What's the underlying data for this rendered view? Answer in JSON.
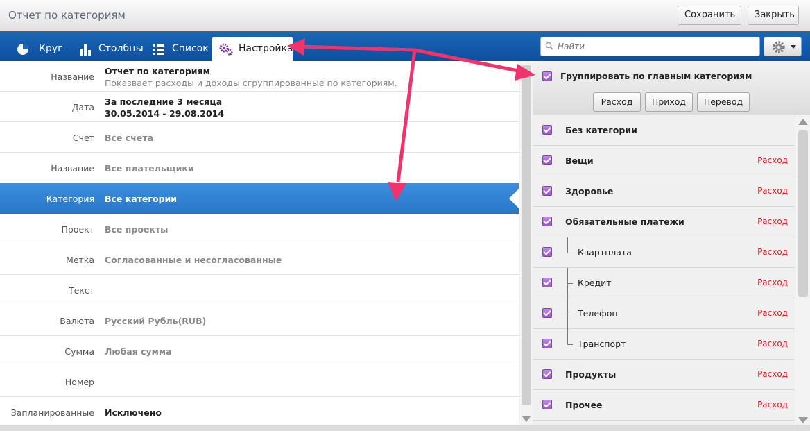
{
  "window": {
    "title": "Отчет по категориям",
    "save_label": "Сохранить",
    "close_label": "Закрыть"
  },
  "tabs": [
    {
      "label": "Круг",
      "icon": "pie-chart-icon"
    },
    {
      "label": "Столбцы",
      "icon": "bar-chart-icon"
    },
    {
      "label": "Список",
      "icon": "list-icon"
    },
    {
      "label": "Настройка",
      "icon": "settings-gears-icon",
      "active": true
    }
  ],
  "settings": {
    "rows": [
      {
        "key": "Название",
        "value": "Отчет по категориям",
        "value2": "Показвает расходы и доходы сгруппированные по категориям."
      },
      {
        "key": "Дата",
        "value": "За последние 3 месяца",
        "value2": "30.05.2014 - 29.08.2014"
      },
      {
        "key": "Счет",
        "value": "Все счета"
      },
      {
        "key": "Название",
        "value": "Все плательщики"
      },
      {
        "key": "Категория",
        "value": "Все категории",
        "selected": true
      },
      {
        "key": "Проект",
        "value": "Все проекты"
      },
      {
        "key": "Метка",
        "value": "Согласованные и несогласованные"
      },
      {
        "key": "Текст",
        "value": ""
      },
      {
        "key": "Валюта",
        "value": "Русский Рубль(RUB)"
      },
      {
        "key": "Сумма",
        "value": "Любая сумма"
      },
      {
        "key": "Номер",
        "value": ""
      },
      {
        "key": "Запланированные",
        "value": "Исключено"
      }
    ]
  },
  "search": {
    "placeholder": "Найти"
  },
  "group": {
    "label": "Группировать по главным категориям",
    "checked": true,
    "filters": [
      "Расход",
      "Приход",
      "Перевод"
    ]
  },
  "categories": [
    {
      "name": "Без категории",
      "type": "",
      "level": 0
    },
    {
      "name": "Вещи",
      "type": "Расход",
      "level": 0
    },
    {
      "name": "Здоровье",
      "type": "Расход",
      "level": 0
    },
    {
      "name": "Обязательные платежи",
      "type": "Расход",
      "level": 0
    },
    {
      "name": "Квартплата",
      "type": "Расход",
      "level": 1
    },
    {
      "name": "Кредит",
      "type": "Расход",
      "level": 1
    },
    {
      "name": "Телефон",
      "type": "Расход",
      "level": 1
    },
    {
      "name": "Транспорт",
      "type": "Расход",
      "level": 1
    },
    {
      "name": "Продукты",
      "type": "Расход",
      "level": 0
    },
    {
      "name": "Прочее",
      "type": "Расход",
      "level": 0
    }
  ],
  "colors": {
    "brand_blue": "#1d66b6",
    "selection_blue": "#3c8ede",
    "checkbox_purple": "#9a58c9",
    "expense_red": "#d21f1f",
    "annotation_arrow": "#f0336b"
  }
}
